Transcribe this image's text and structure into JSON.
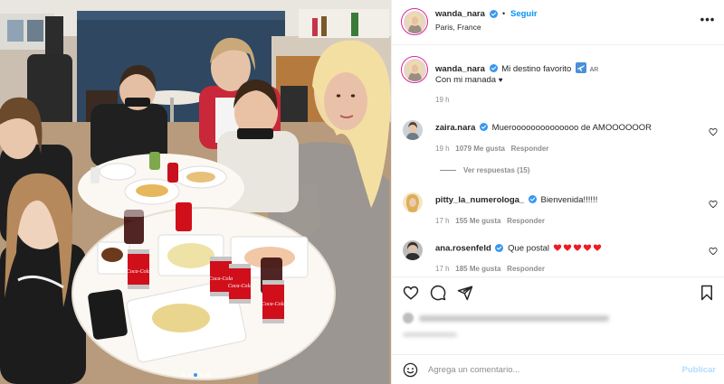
{
  "photo": {
    "alt": "",
    "carousel_count": 5,
    "carousel_active": 2,
    "can_brand": "Coca-Cola"
  },
  "header": {
    "username": "wanda_nara",
    "separator": "•",
    "follow_label": "Seguir",
    "location": "Paris, France"
  },
  "caption": {
    "username": "wanda_nara",
    "text_line1": "Mi destino favorito",
    "flag": "AR",
    "text_line2": "Con mi manada",
    "time": "19 h"
  },
  "comments": [
    {
      "username": "zaira.nara",
      "text": "Mueroooooooooooooo de AMOOOOOOR",
      "time": "19 h",
      "likes": "1079 Me gusta",
      "reply": "Responder",
      "view_replies": "Ver respuestas (15)"
    },
    {
      "username": "pitty_la_numerologa_",
      "text": "Bienvenida!!!!!!",
      "time": "17 h",
      "likes": "155 Me gusta",
      "reply": "Responder"
    },
    {
      "username": "ana.rosenfeld",
      "text": "Que postal",
      "hearts": 5,
      "time": "17 h",
      "likes": "185 Me gusta",
      "reply": "Responder"
    }
  ],
  "composer": {
    "placeholder": "Agrega un comentario...",
    "publish_label": "Publicar"
  },
  "colors": {
    "accent": "#0095f6",
    "heart_red": "#ed1c24",
    "muted": "#8e8e8e",
    "verified": "#3897f0"
  },
  "icons": [
    "verified-badge-icon",
    "more-options-icon",
    "heart-icon",
    "comment-icon",
    "share-icon",
    "bookmark-icon",
    "emoji-icon",
    "airplane-emoji-icon",
    "black-heart-emoji-icon"
  ]
}
